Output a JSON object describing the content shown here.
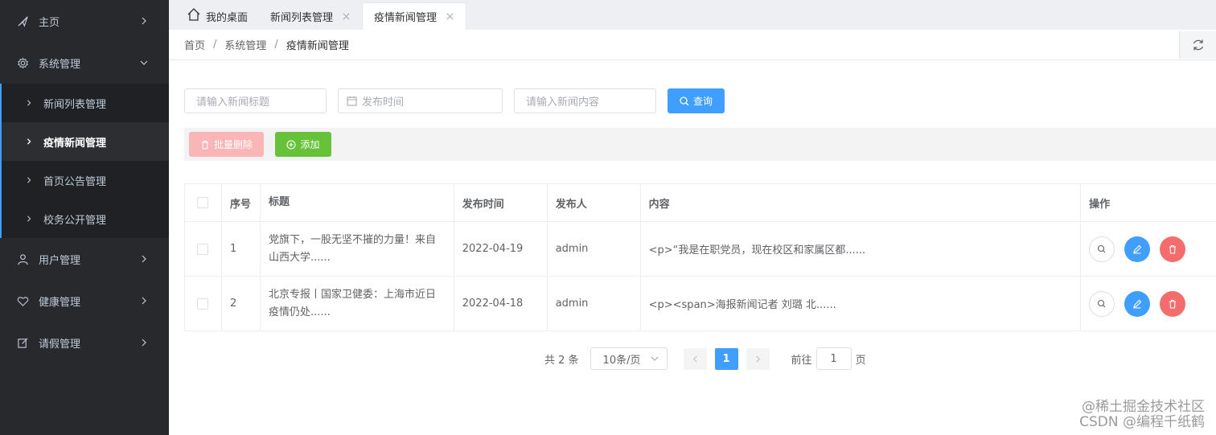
{
  "sidebar": {
    "items": [
      {
        "label": "主页",
        "icon": "send-icon"
      },
      {
        "label": "系统管理",
        "icon": "gear-icon",
        "expanded": true
      },
      {
        "label": "用户管理",
        "icon": "user-icon"
      },
      {
        "label": "健康管理",
        "icon": "heart-icon"
      },
      {
        "label": "请假管理",
        "icon": "edit-icon"
      }
    ],
    "submenu": [
      {
        "label": "新闻列表管理"
      },
      {
        "label": "疫情新闻管理",
        "active": true
      },
      {
        "label": "首页公告管理"
      },
      {
        "label": "校务公开管理"
      }
    ]
  },
  "tabs": [
    {
      "label": "我的桌面"
    },
    {
      "label": "新闻列表管理"
    },
    {
      "label": "疫情新闻管理",
      "active": true
    }
  ],
  "breadcrumb": [
    "首页",
    "系统管理",
    "疫情新闻管理"
  ],
  "search": {
    "title_placeholder": "请输入新闻标题",
    "time_placeholder": "发布时间",
    "content_placeholder": "请输入新闻内容",
    "query_label": "查询"
  },
  "toolbar": {
    "batch_delete_label": "批量删除",
    "add_label": "添加"
  },
  "table": {
    "headers": {
      "index": "序号",
      "title": "标题",
      "time": "发布时间",
      "publisher": "发布人",
      "content": "内容",
      "actions": "操作"
    },
    "rows": [
      {
        "index": "1",
        "title": "党旗下，一股无坚不摧的力量！来自山西大学......",
        "time": "2022-04-19",
        "publisher": "admin",
        "content": "<p>“我是在职党员，现在校区和家属区都......"
      },
      {
        "index": "2",
        "title": "北京专报丨国家卫健委：上海市近日疫情仍处......",
        "time": "2022-04-18",
        "publisher": "admin",
        "content": "<p><span>海报新闻记者 刘璐 北......"
      }
    ]
  },
  "pagination": {
    "total_text": "共 2 条",
    "page_size": "10条/页",
    "current_page": "1",
    "goto_label": "前往",
    "goto_value": "1",
    "page_suffix": "页"
  },
  "watermark": {
    "line1": "@稀土掘金技术社区",
    "line2": "CSDN @编程千纸鹤"
  },
  "colors": {
    "primary": "#409eff",
    "success": "#67c23a",
    "danger": "#f56c6c",
    "sidebar_bg": "#28292c"
  }
}
